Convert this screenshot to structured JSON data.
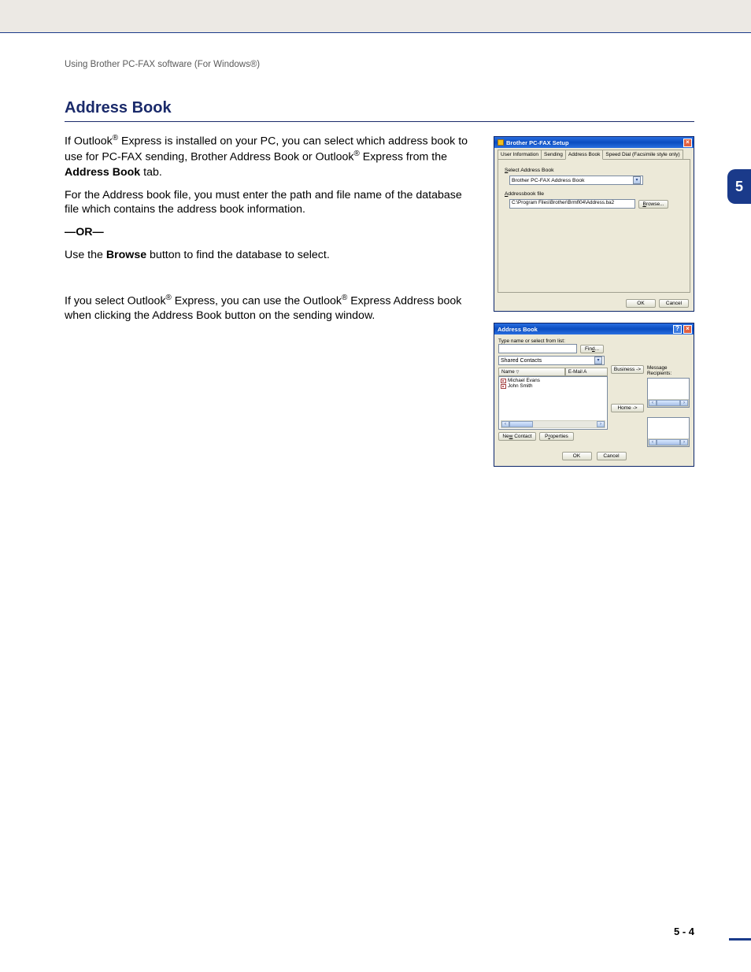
{
  "breadcrumb": "Using Brother PC-FAX software (For Windows®)",
  "section_title": "Address Book",
  "chapter_tab": "5",
  "page_number": "5 - 4",
  "para1_a": "If Outlook",
  "para1_b": " Express is installed on your PC, you can select which address book to use for PC-FAX sending, Brother Address Book or Outlook",
  "para1_c": " Express from the ",
  "para1_bold": "Address Book",
  "para1_d": " tab.",
  "para2": "For the Address book file, you must enter the path and file name of the database file which contains the address book information.",
  "or_text": "—OR—",
  "para3_a": "Use the ",
  "para3_bold": "Browse",
  "para3_b": " button to find the database to select.",
  "para4_a": "If you select Outlook",
  "para4_b": " Express, you can use the Outlook",
  "para4_c": " Express Address book when clicking the Address Book button on the sending window.",
  "reg": "®",
  "dlg1": {
    "title": "Brother PC-FAX Setup",
    "tabs": [
      "User Information",
      "Sending",
      "Address Book",
      "Speed Dial (Facsimile style only)"
    ],
    "active_tab": 2,
    "label_select": "Select Address Book",
    "combo_value": "Brother PC-FAX Address Book",
    "label_file": "Addressbook file",
    "path_value": "C:\\Program Files\\Brother\\Brmfl04\\Address.ba2",
    "browse": "Browse...",
    "ok": "OK",
    "cancel": "Cancel"
  },
  "dlg2": {
    "title": "Address Book",
    "type_label": "Type name or select from list:",
    "find": "Find...",
    "shared_combo": "Shared Contacts",
    "col_name": "Name",
    "col_email": "E-Mail A",
    "items": [
      "Michael Evans",
      "John Smith"
    ],
    "business": "Business ->",
    "home": "Home ->",
    "recipients_label": "Message Recipients:",
    "new_contact": "New Contact",
    "properties": "Properties",
    "ok": "OK",
    "cancel": "Cancel"
  }
}
